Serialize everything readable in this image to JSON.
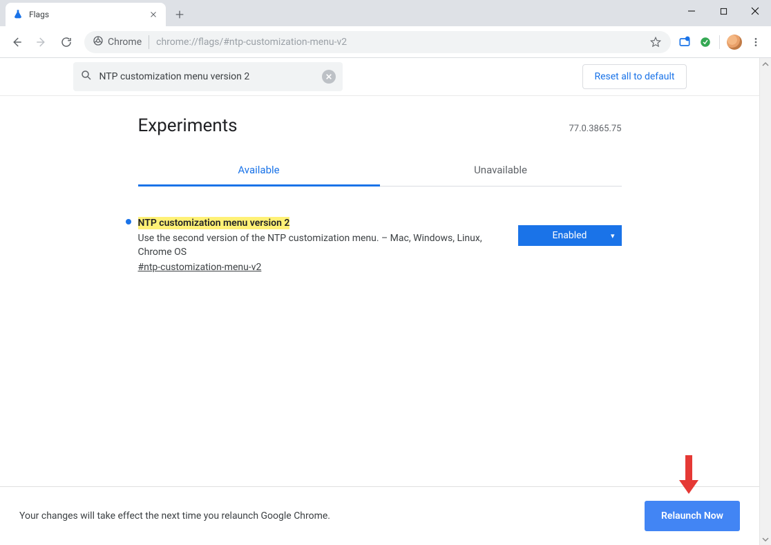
{
  "browser": {
    "tab_title": "Flags",
    "omnibox_chip": "Chrome",
    "omnibox_url": "chrome://flags/#ntp-customization-menu-v2"
  },
  "search": {
    "value": "NTP customization menu version 2",
    "reset_label": "Reset all to default"
  },
  "header": {
    "title": "Experiments",
    "version": "77.0.3865.75"
  },
  "tabs": {
    "available": "Available",
    "unavailable": "Unavailable"
  },
  "flag": {
    "title": "NTP customization menu version 2",
    "description": "Use the second version of the NTP customization menu. – Mac, Windows, Linux, Chrome OS",
    "hash": "#ntp-customization-menu-v2",
    "select_value": "Enabled"
  },
  "footer": {
    "message": "Your changes will take effect the next time you relaunch Google Chrome.",
    "relaunch_label": "Relaunch Now"
  }
}
